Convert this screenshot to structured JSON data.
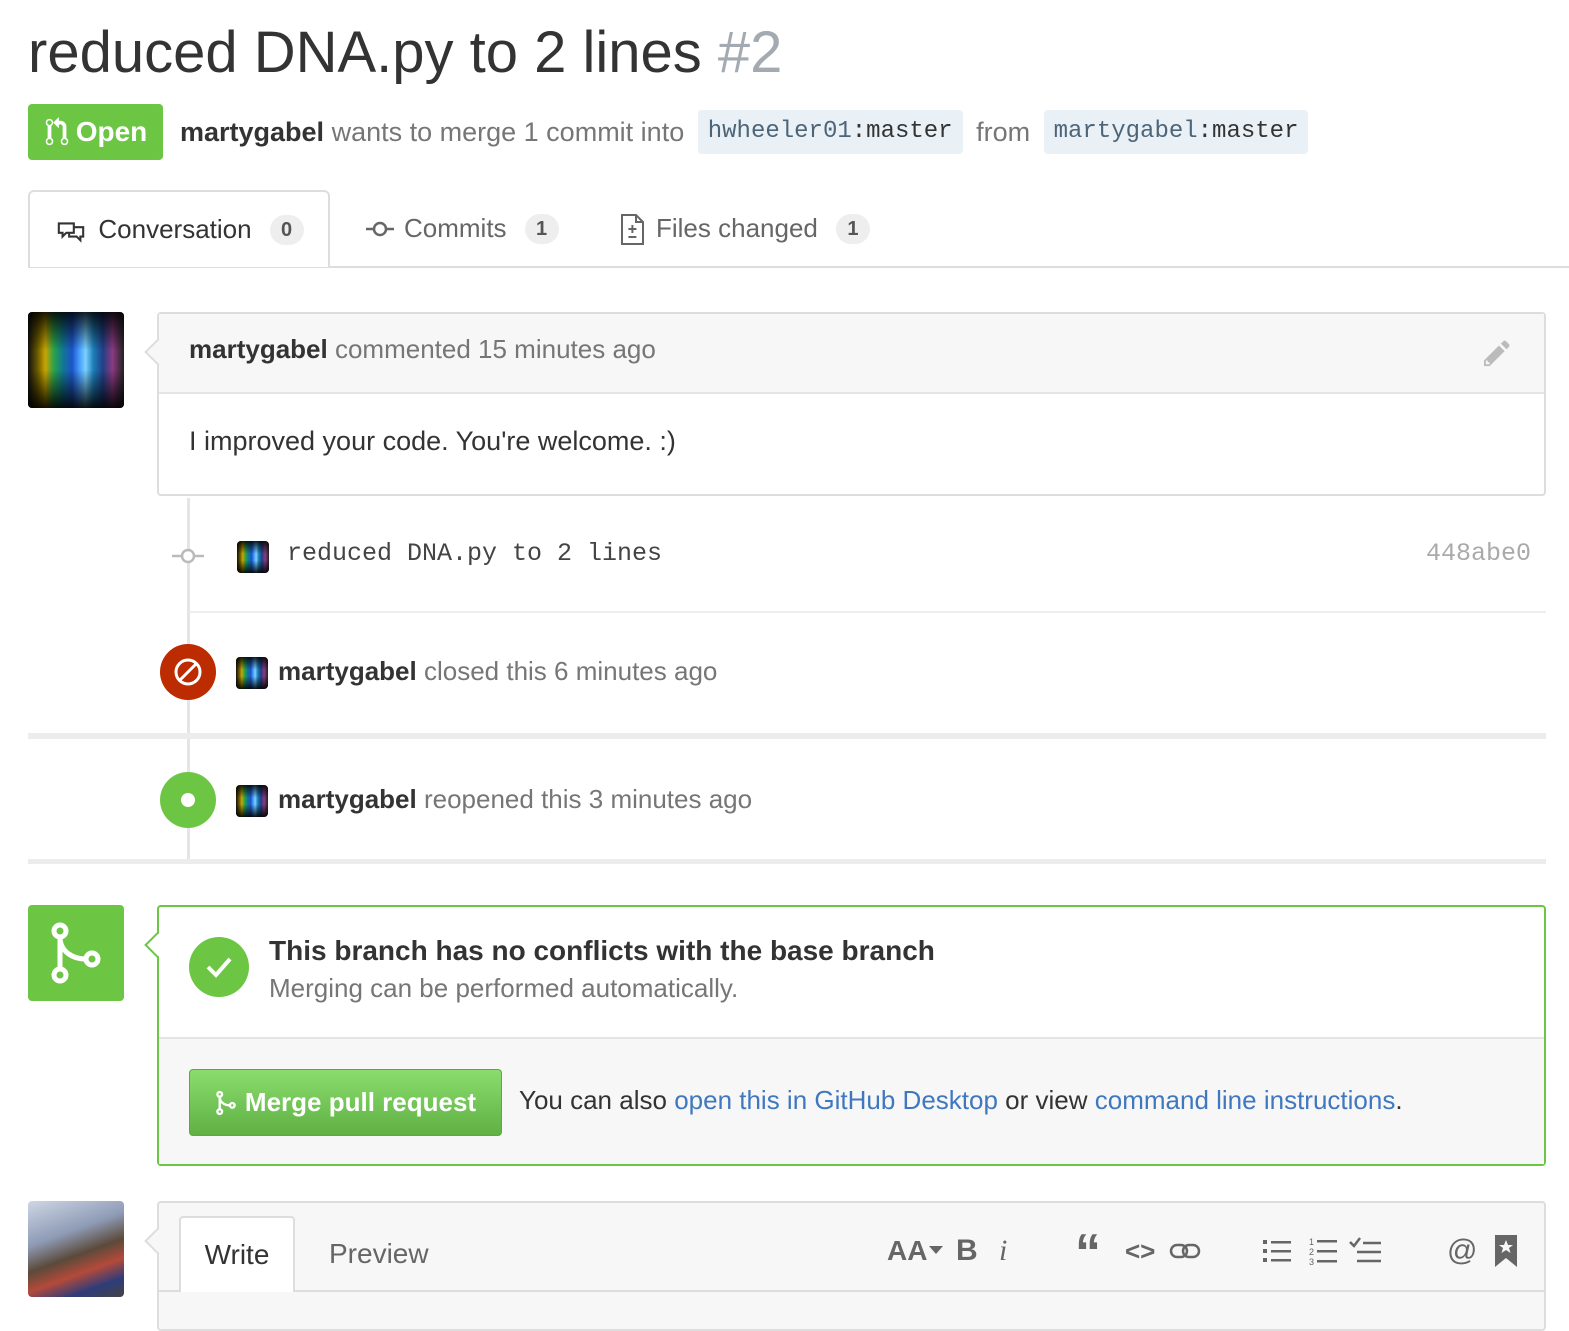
{
  "pr": {
    "title": "reduced DNA.py to 2 lines",
    "number": "#2",
    "state": "Open",
    "author": "martygabel",
    "merge_text": "wants to merge 1 commit into",
    "base_user": "hwheeler01",
    "base_branch": ":master",
    "from_text": "from",
    "head_user": "martygabel",
    "head_branch": ":master"
  },
  "tabs": [
    {
      "label": "Conversation",
      "count": "0"
    },
    {
      "label": "Commits",
      "count": "1"
    },
    {
      "label": "Files changed",
      "count": "1"
    }
  ],
  "comment": {
    "author": "martygabel",
    "meta": "commented 15 minutes ago",
    "body": "I improved your code. You're welcome. :)"
  },
  "commit": {
    "message": "reduced DNA.py to 2 lines",
    "sha": "448abe0"
  },
  "events": {
    "closed": {
      "author": "martygabel",
      "text": "closed this 6 minutes ago"
    },
    "reopened": {
      "author": "martygabel",
      "text": "reopened this 3 minutes ago"
    }
  },
  "merge": {
    "title": "This branch has no conflicts with the base branch",
    "subtitle": "Merging can be performed automatically.",
    "button": "Merge pull request",
    "hint_prefix": "You can also",
    "desktop_link": "open this in GitHub Desktop",
    "hint_middle": "or view",
    "cli_link": "command line instructions",
    "hint_suffix": "."
  },
  "editor": {
    "write_tab": "Write",
    "preview_tab": "Preview",
    "toolbar": {
      "heading": "AA",
      "bold": "B",
      "italic": "i",
      "quote": "“",
      "code": "<>",
      "mention": "@"
    }
  },
  "colors": {
    "open_green": "#6cc644",
    "closed_red": "#bd2c00",
    "link_blue": "#4078c0"
  }
}
